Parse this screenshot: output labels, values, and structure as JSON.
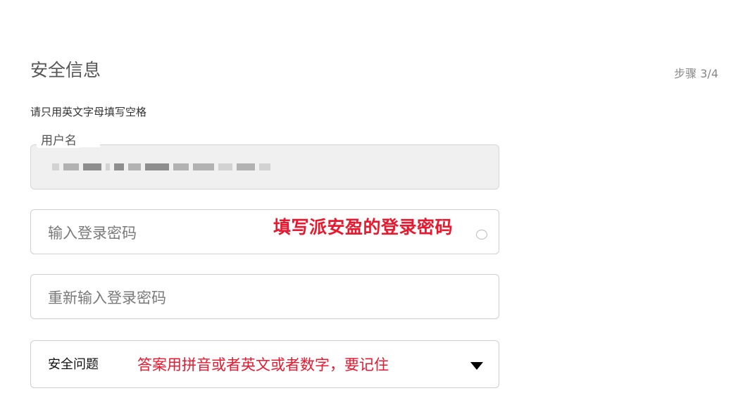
{
  "section": {
    "title": "安全信息",
    "step": "步骤 3/4",
    "hint": "请只用英文字母填写空格"
  },
  "username": {
    "legend": "用户名",
    "value_blurred": true
  },
  "password": {
    "placeholder": "输入登录密码",
    "annotation": "填写派安盈的登录密码"
  },
  "password_confirm": {
    "placeholder": "重新输入登录密码"
  },
  "security_question": {
    "label": "安全问题",
    "note": "答案用拼音或者英文或者数字，要记住",
    "icon": "caret-down-icon"
  },
  "colors": {
    "annotation_red": "#e8182f",
    "border": "#cfcfcf",
    "disabled_bg": "#f0f0f0"
  }
}
